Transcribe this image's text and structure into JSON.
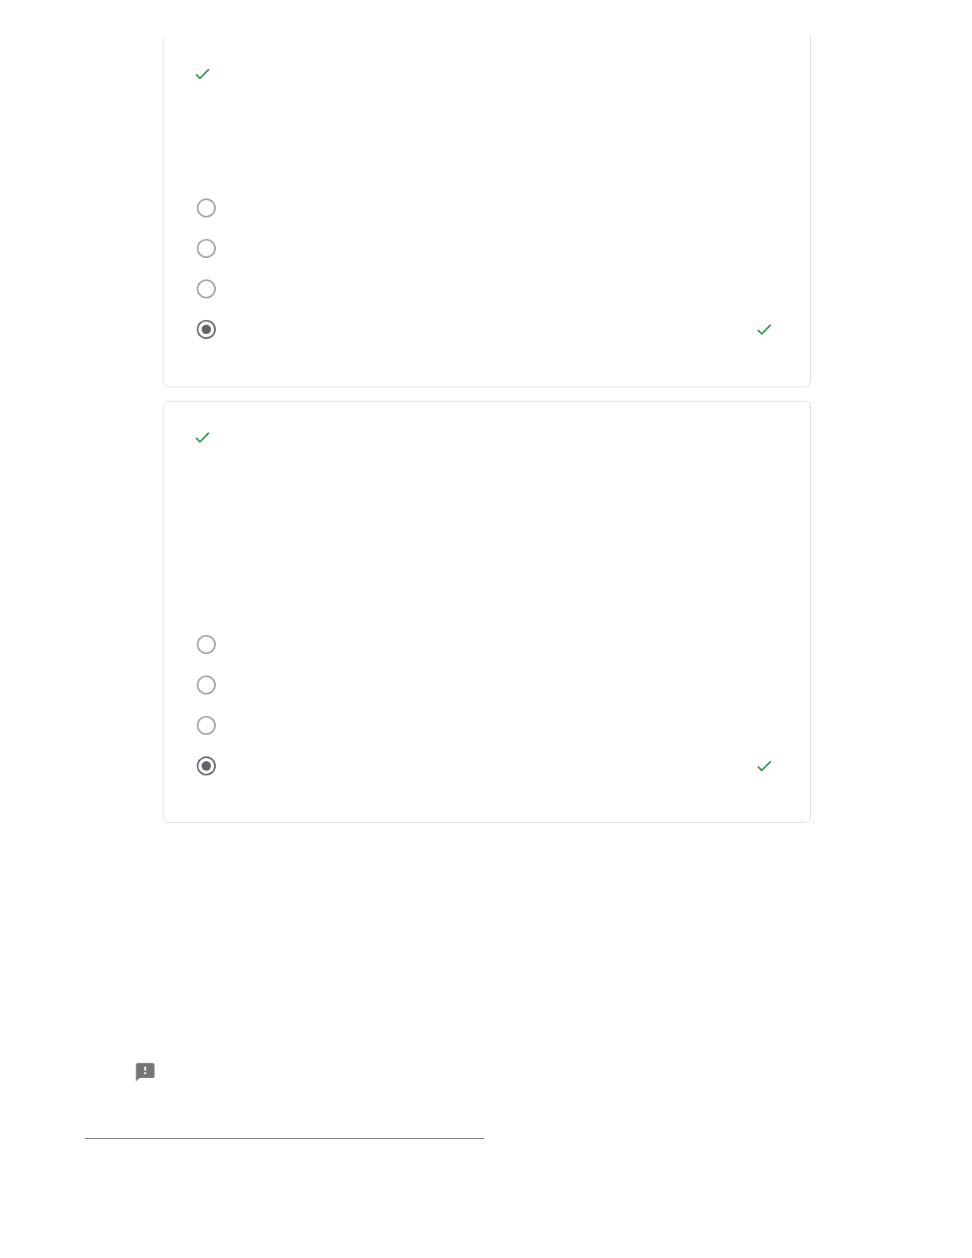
{
  "questions": [
    {
      "correct": true,
      "options": [
        {
          "selected": false,
          "correct": false
        },
        {
          "selected": false,
          "correct": false
        },
        {
          "selected": false,
          "correct": false
        },
        {
          "selected": true,
          "correct": true
        }
      ]
    },
    {
      "correct": true,
      "options": [
        {
          "selected": false,
          "correct": false
        },
        {
          "selected": false,
          "correct": false
        },
        {
          "selected": false,
          "correct": false
        },
        {
          "selected": true,
          "correct": true
        }
      ]
    }
  ]
}
